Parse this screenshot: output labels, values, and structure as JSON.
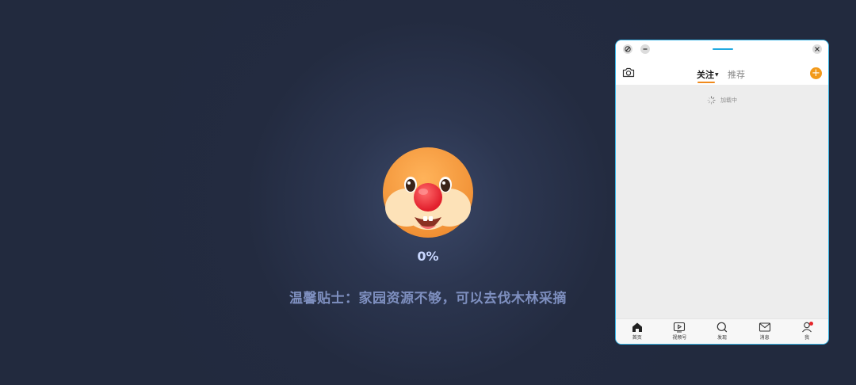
{
  "game": {
    "progress": "0%",
    "progress_value": 0,
    "tip": "温馨贴士：家园资源不够，可以去伐木林采摘"
  },
  "phone": {
    "topnav": {
      "tab_follow": "关注",
      "tab_recommend": "推荐",
      "camera_icon": "camera-icon",
      "add_icon": "plus-icon"
    },
    "feed": {
      "loading_text": "加载中"
    },
    "bottombar": {
      "items": [
        {
          "label": "首页",
          "icon": "home-icon"
        },
        {
          "label": "视频号",
          "icon": "video-icon"
        },
        {
          "label": "发现",
          "icon": "search-icon"
        },
        {
          "label": "消息",
          "icon": "mail-icon"
        },
        {
          "label": "我",
          "icon": "user-icon"
        }
      ]
    },
    "colors": {
      "accent": "#f08a1c",
      "border": "#38b5e6",
      "badge": "#e5262b"
    }
  }
}
